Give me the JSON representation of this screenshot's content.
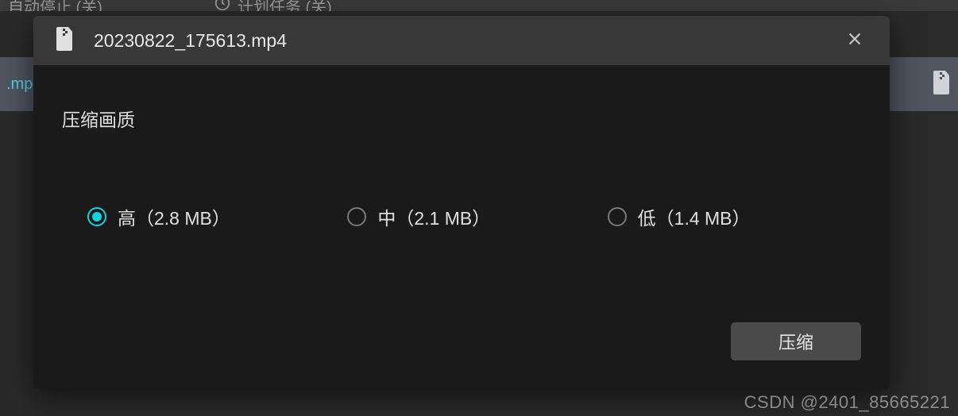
{
  "background": {
    "auto_stop": "自动停止 (关)",
    "scheduled_task": "计划任务 (关)",
    "file_ext_fragment": ".mp"
  },
  "modal": {
    "filename": "20230822_175613.mp4",
    "section_title": "压缩画质",
    "options": [
      {
        "label": "高（2.8 MB）",
        "selected": true
      },
      {
        "label": "中（2.1 MB）",
        "selected": false
      },
      {
        "label": "低（1.4 MB）",
        "selected": false
      }
    ],
    "action_button": "压缩"
  },
  "watermark": "CSDN @2401_85665221"
}
